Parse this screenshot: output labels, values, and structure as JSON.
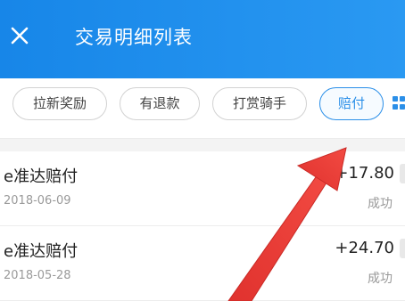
{
  "header": {
    "title": "交易明细列表",
    "close_icon": "close-icon"
  },
  "filters": {
    "chips": [
      {
        "label": "拉新奖励",
        "active": false
      },
      {
        "label": "有退款",
        "active": false
      },
      {
        "label": "打赏骑手",
        "active": false
      },
      {
        "label": "赔付",
        "active": true
      }
    ],
    "more_icon": "grid-icon"
  },
  "transactions": [
    {
      "name": "e准达赔付",
      "date": "2018-06-09",
      "amount": "+17.80",
      "status": "成功"
    },
    {
      "name": "e准达赔付",
      "date": "2018-05-28",
      "amount": "+24.70",
      "status": "成功"
    }
  ],
  "colors": {
    "header_blue": "#1786e8",
    "accent": "#2b8fe8",
    "annotation_arrow": "#ea3b36"
  }
}
